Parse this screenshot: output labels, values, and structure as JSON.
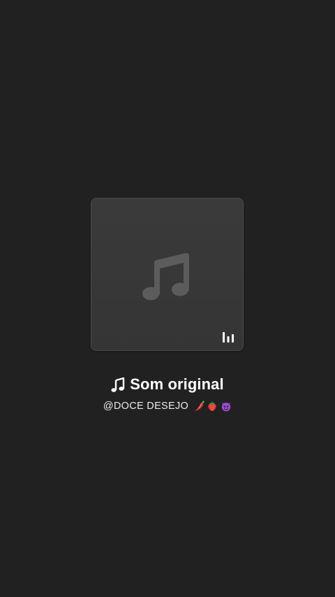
{
  "audio": {
    "title": "Som original",
    "author": "@DOCE DESEJO",
    "author_emojis": [
      "chili-pepper-icon",
      "strawberry-icon",
      "smiling-devil-icon"
    ]
  },
  "icons": {
    "artwork": "music-note-icon",
    "playing_indicator": "equalizer-icon",
    "title_prefix": "music-note-icon"
  },
  "colors": {
    "background": "#212121",
    "card": "#383838",
    "card_border": "#4b4b4b",
    "note_on_card": "#5c5c5c",
    "title_text": "#ffffff",
    "subtitle_text": "#e9e9e9"
  }
}
